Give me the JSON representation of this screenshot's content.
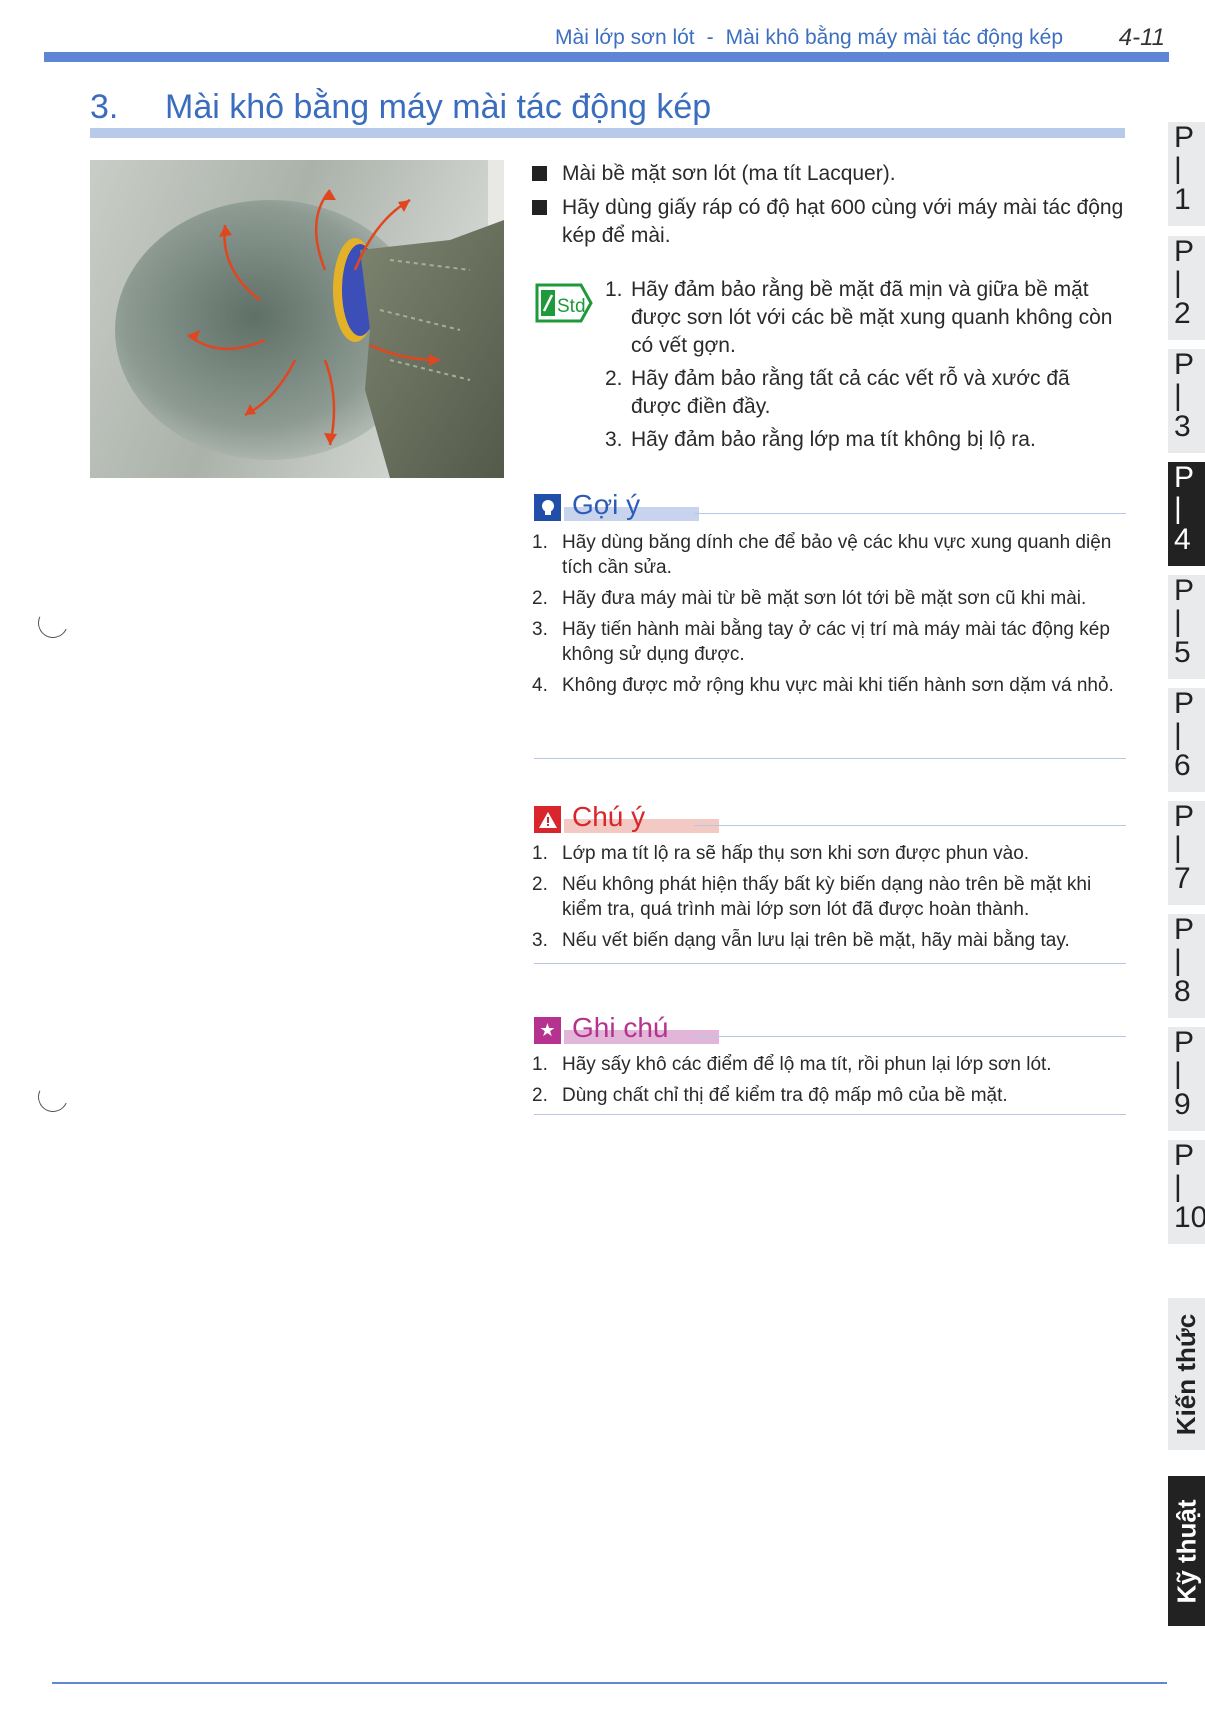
{
  "header": {
    "breadcrumb_left": "Mài lớp sơn lót",
    "separator": "-",
    "breadcrumb_right": "Mài khô bằng máy mài tác động kép",
    "page_number": "4-11"
  },
  "section": {
    "number": "3.",
    "title": "Mài khô bằng máy mài tác động kép"
  },
  "bullets": [
    "Mài bề mặt sơn lót (ma tít Lacquer).",
    "Hãy dùng giấy ráp có độ hạt 600 cùng với máy mài tác động kép để mài."
  ],
  "std": {
    "badge": "Std",
    "items": [
      "Hãy đảm bảo rằng bề mặt đã mịn và giữa bề mặt được sơn lót với các bề mặt xung quanh không còn có vết gợn.",
      "Hãy đảm bảo rằng tất cả các vết rỗ và xước đã được điền đầy.",
      "Hãy đảm bảo rằng lớp ma tít không bị lộ ra."
    ]
  },
  "hint": {
    "title": "Gợi ý",
    "icon": "lightbulb-icon",
    "color": "#1f4fa8",
    "items": [
      "Hãy dùng băng dính che để bảo vệ các khu vực xung quanh diện tích cần sửa.",
      "Hãy đưa máy mài từ bề mặt sơn lót tới bề mặt sơn cũ khi mài.",
      "Hãy tiến hành mài bằng tay ở các vị trí mà máy mài tác động kép không sử dụng được.",
      "Không được mở rộng khu vực mài khi tiến hành sơn dặm vá nhỏ."
    ]
  },
  "caution": {
    "title": "Chú ý",
    "icon": "warning-icon",
    "color": "#d9262c",
    "items": [
      "Lớp ma tít lộ ra sẽ hấp thụ sơn khi sơn được phun vào.",
      "Nếu không phát hiện thấy bất kỳ biến dạng nào trên bề mặt khi kiểm tra, quá trình mài lớp sơn lót đã được hoàn thành.",
      "Nếu vết biến dạng vẫn lưu lại trên bề mặt, hãy mài bằng tay."
    ]
  },
  "note": {
    "title": "Ghi chú",
    "icon": "star-icon",
    "color": "#b5338e",
    "items": [
      "Hãy sấy khô các điểm để lộ ma tít, rồi phun lại lớp sơn lót.",
      "Dùng chất chỉ thị để kiểm tra độ mấp mô của bề mặt."
    ]
  },
  "tabs": [
    {
      "label": "P",
      "num": "1"
    },
    {
      "label": "P",
      "num": "2"
    },
    {
      "label": "P",
      "num": "3"
    },
    {
      "label": "P",
      "num": "4",
      "active": true
    },
    {
      "label": "P",
      "num": "5"
    },
    {
      "label": "P",
      "num": "6"
    },
    {
      "label": "P",
      "num": "7"
    },
    {
      "label": "P",
      "num": "8"
    },
    {
      "label": "P",
      "num": "9"
    },
    {
      "label": "P",
      "num": "10"
    }
  ],
  "side_tabs": {
    "knowledge": "Kiến thức",
    "technique": "Kỹ thuật"
  }
}
